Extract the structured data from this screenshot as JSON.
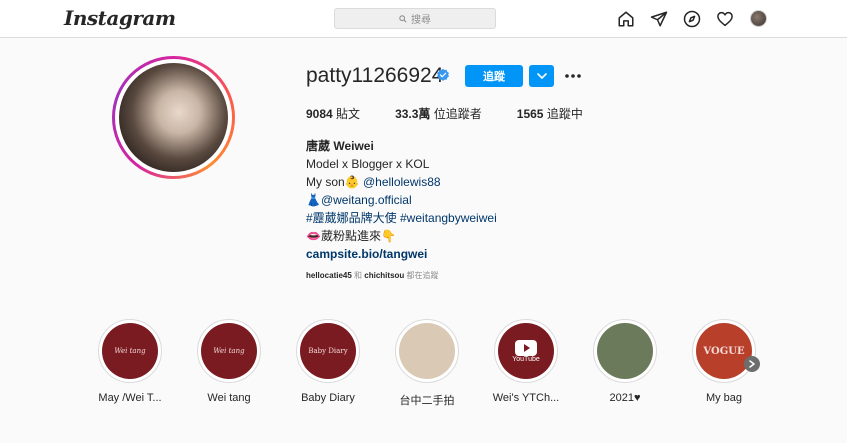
{
  "header": {
    "logo": "Instagram",
    "search_placeholder": "搜尋"
  },
  "profile": {
    "username": "patty11266924",
    "follow_label": "追蹤",
    "stats": {
      "posts_count": "9084",
      "posts_label": "貼文",
      "followers_count": "33.3萬",
      "followers_label": "位追蹤者",
      "following_count": "1565",
      "following_label": "追蹤中"
    },
    "bio": {
      "name": "唐葳 Weiwei",
      "line1": "Model x Blogger x KOL",
      "line2_text": "My son",
      "line2_emoji": "👶",
      "line2_link": "@hellolewis88",
      "line3_emoji": "👗",
      "line3_link": "@weitang.official",
      "line4": "#靂葳娜品牌大使 #weitangbyweiwei",
      "line5_emoji": "👄",
      "line5_text": "葳粉點進來",
      "line5_emoji2": "👇",
      "website": "campsite.bio/tangwei"
    },
    "followed_by": {
      "user1": "hellocatie45",
      "and": "和",
      "user2": "chichitsou",
      "suffix": "都在追蹤"
    }
  },
  "highlights": [
    {
      "label": "May /Wei T...",
      "inner_text": "Wei tang",
      "bg": "#7a1b22"
    },
    {
      "label": "Wei tang",
      "inner_text": "Wei tang",
      "bg": "#7a1b22"
    },
    {
      "label": "Baby Diary",
      "inner_text": "Baby Diary",
      "bg": "#7a1b22"
    },
    {
      "label": "台中二手拍",
      "inner_text": "",
      "bg": "#d9c9b5"
    },
    {
      "label": "Wei's YTCh...",
      "inner_text": "YouTube",
      "bg": "#7a1b22"
    },
    {
      "label": "2021♥",
      "inner_text": "",
      "bg": "#6b7a5a"
    },
    {
      "label": "My bag",
      "inner_text": "VOGUE",
      "bg": "#b8402a"
    }
  ],
  "colors": {
    "accent": "#0095f6",
    "link": "#00376b",
    "highlight_maroon": "#7a1b22"
  }
}
